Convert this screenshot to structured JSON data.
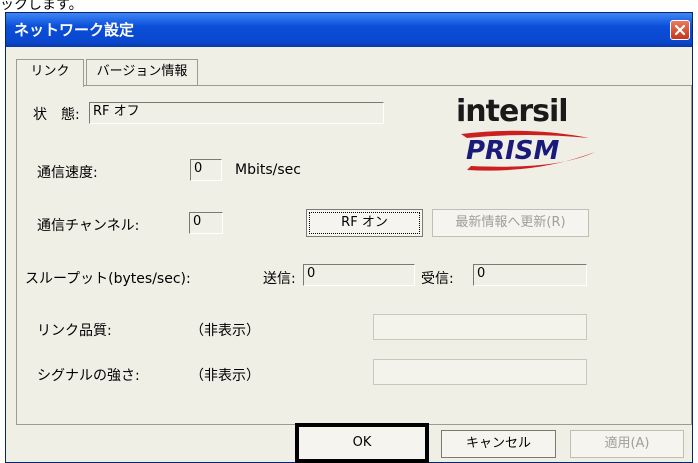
{
  "caption_text": "ックします。",
  "window": {
    "title": "ネットワーク設定",
    "close_icon": "close-icon"
  },
  "tabs": [
    {
      "label": "リンク",
      "active": true
    },
    {
      "label": "バージョン情報",
      "active": false
    }
  ],
  "fields": {
    "status": {
      "label": "状　態:",
      "value": "RF オフ"
    },
    "speed": {
      "label": "通信速度:",
      "value": "0",
      "unit": "Mbits/sec"
    },
    "channel": {
      "label": "通信チャンネル:",
      "value": "0"
    },
    "throughput": {
      "label": "スループット(bytes/sec):",
      "send_label": "送信:",
      "send_value": "0",
      "recv_label": "受信:",
      "recv_value": "0"
    },
    "link_quality": {
      "label": "リンク品質:",
      "value": "（非表示）"
    },
    "signal": {
      "label": "シグナルの強さ:",
      "value": "（非表示）"
    }
  },
  "buttons": {
    "rf_on": "RF オン",
    "refresh": "最新情報へ更新(R)",
    "ok": "OK",
    "cancel": "キャンセル",
    "apply": "適用(A)"
  },
  "logo": {
    "brand1": "intersil",
    "brand2": "PRISM",
    "accent_color": "#cc1f1f",
    "brand_color": "#1a1a7a"
  }
}
